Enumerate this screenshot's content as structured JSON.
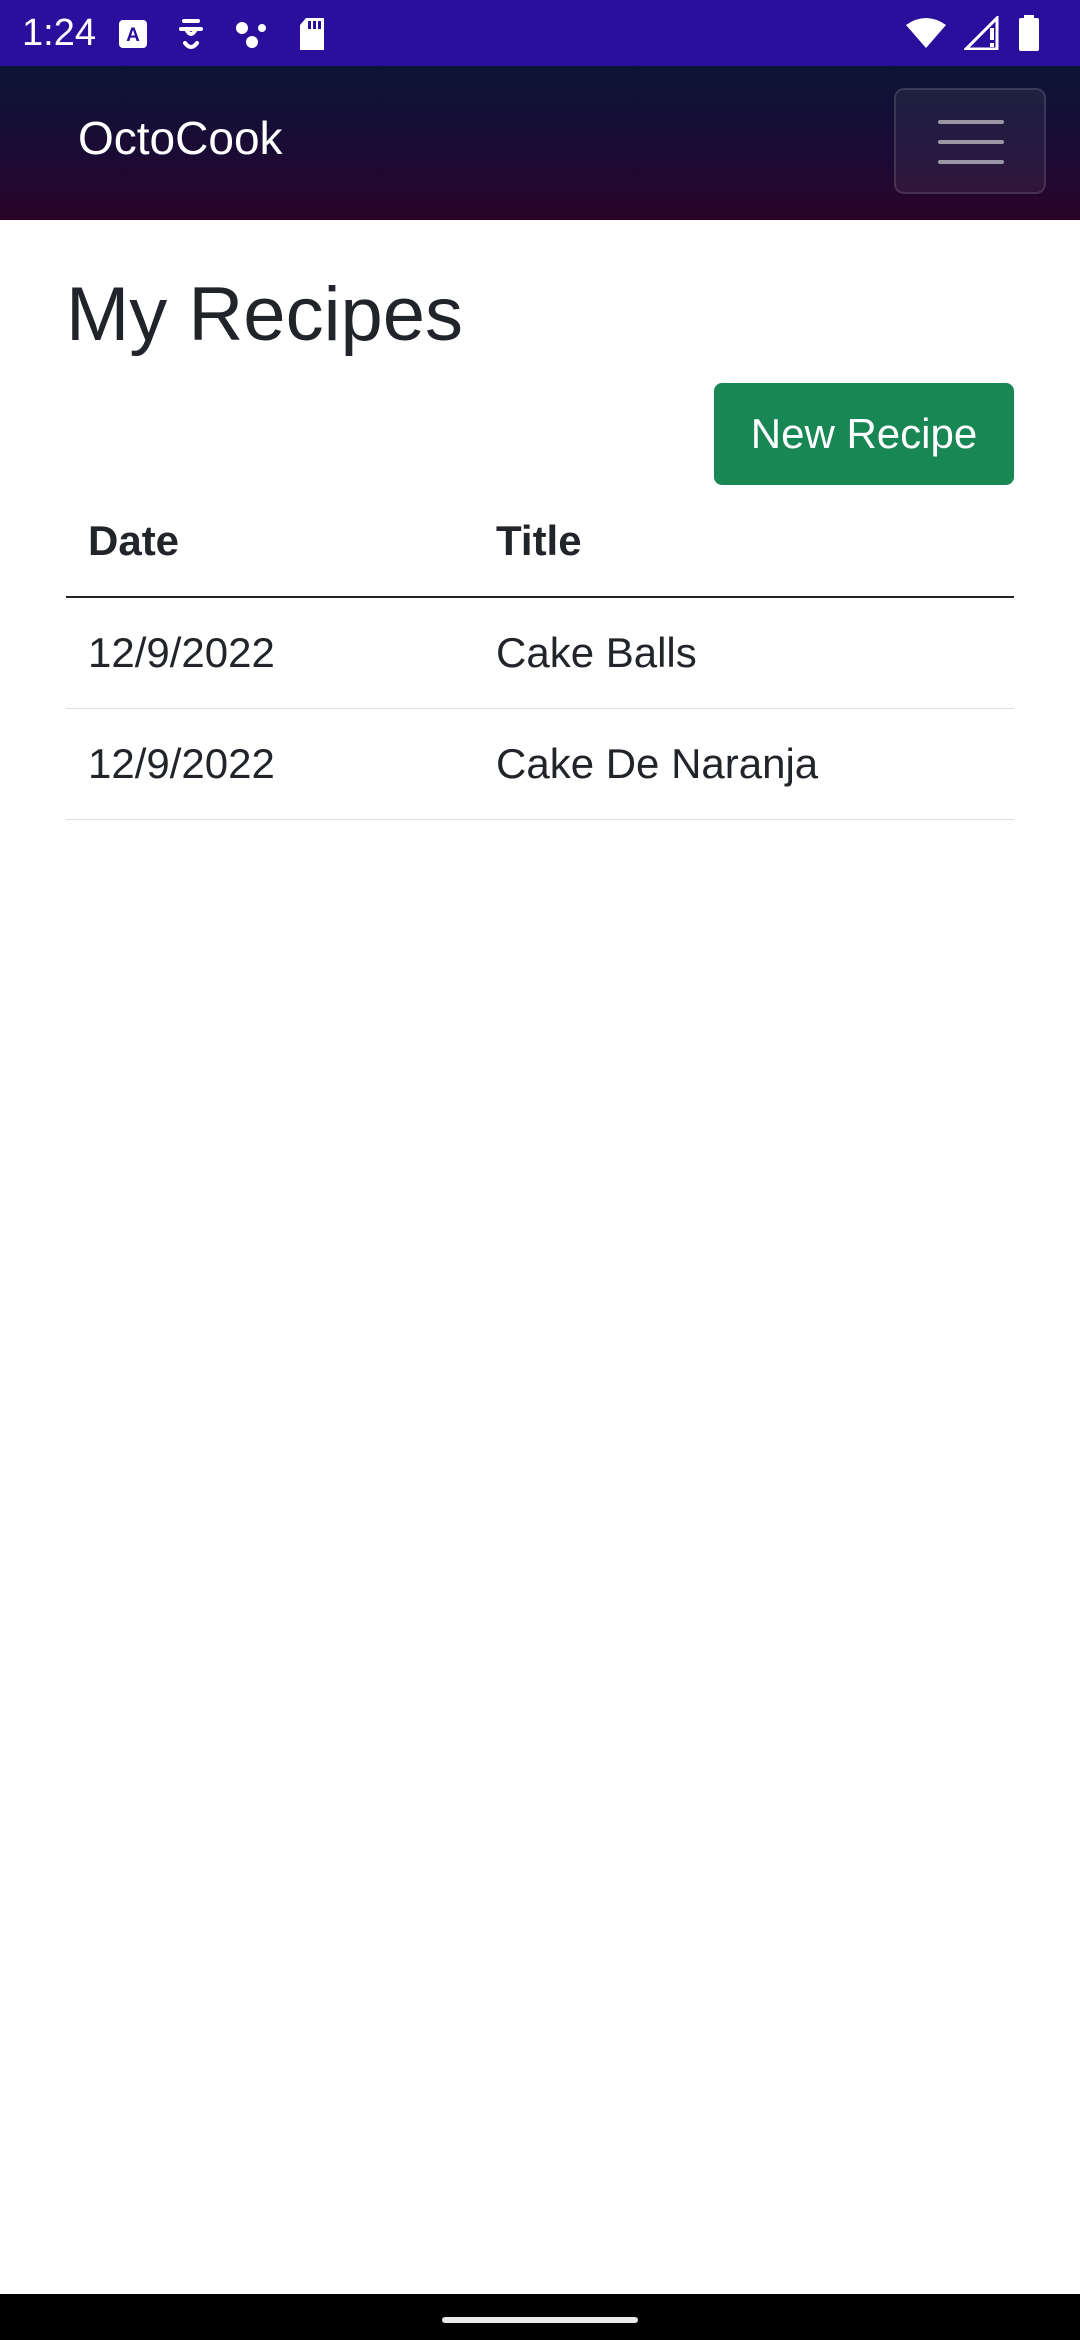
{
  "status_bar": {
    "time": "1:24",
    "left_icons": [
      "a-box-icon",
      "accessibility-icon",
      "dots-icon",
      "sd-card-icon"
    ],
    "right_icons": [
      "wifi-icon",
      "signal-icon",
      "battery-icon"
    ],
    "background_color": "#2a0e9c"
  },
  "navbar": {
    "brand": "OctoCook",
    "menu_icon": "hamburger-icon"
  },
  "main": {
    "title": "My Recipes",
    "new_recipe_label": "New Recipe",
    "accent_color": "#198754",
    "table": {
      "headers": [
        "Date",
        "Title"
      ],
      "rows": [
        [
          "12/9/2022",
          "Cake Balls"
        ],
        [
          "12/9/2022",
          "Cake De Naranja"
        ]
      ]
    }
  }
}
